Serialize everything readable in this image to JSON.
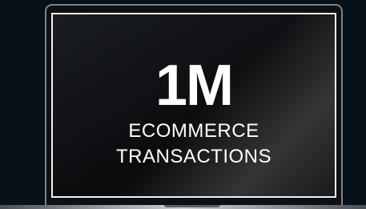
{
  "stat": {
    "value": "1M",
    "label_line1": "ECOMMERCE",
    "label_line2": "TRANSACTIONS"
  },
  "colors": {
    "background": "#06111a",
    "screen": "#0e1013",
    "text": "#ffffff",
    "bezel_border": "#f2f2f2"
  }
}
